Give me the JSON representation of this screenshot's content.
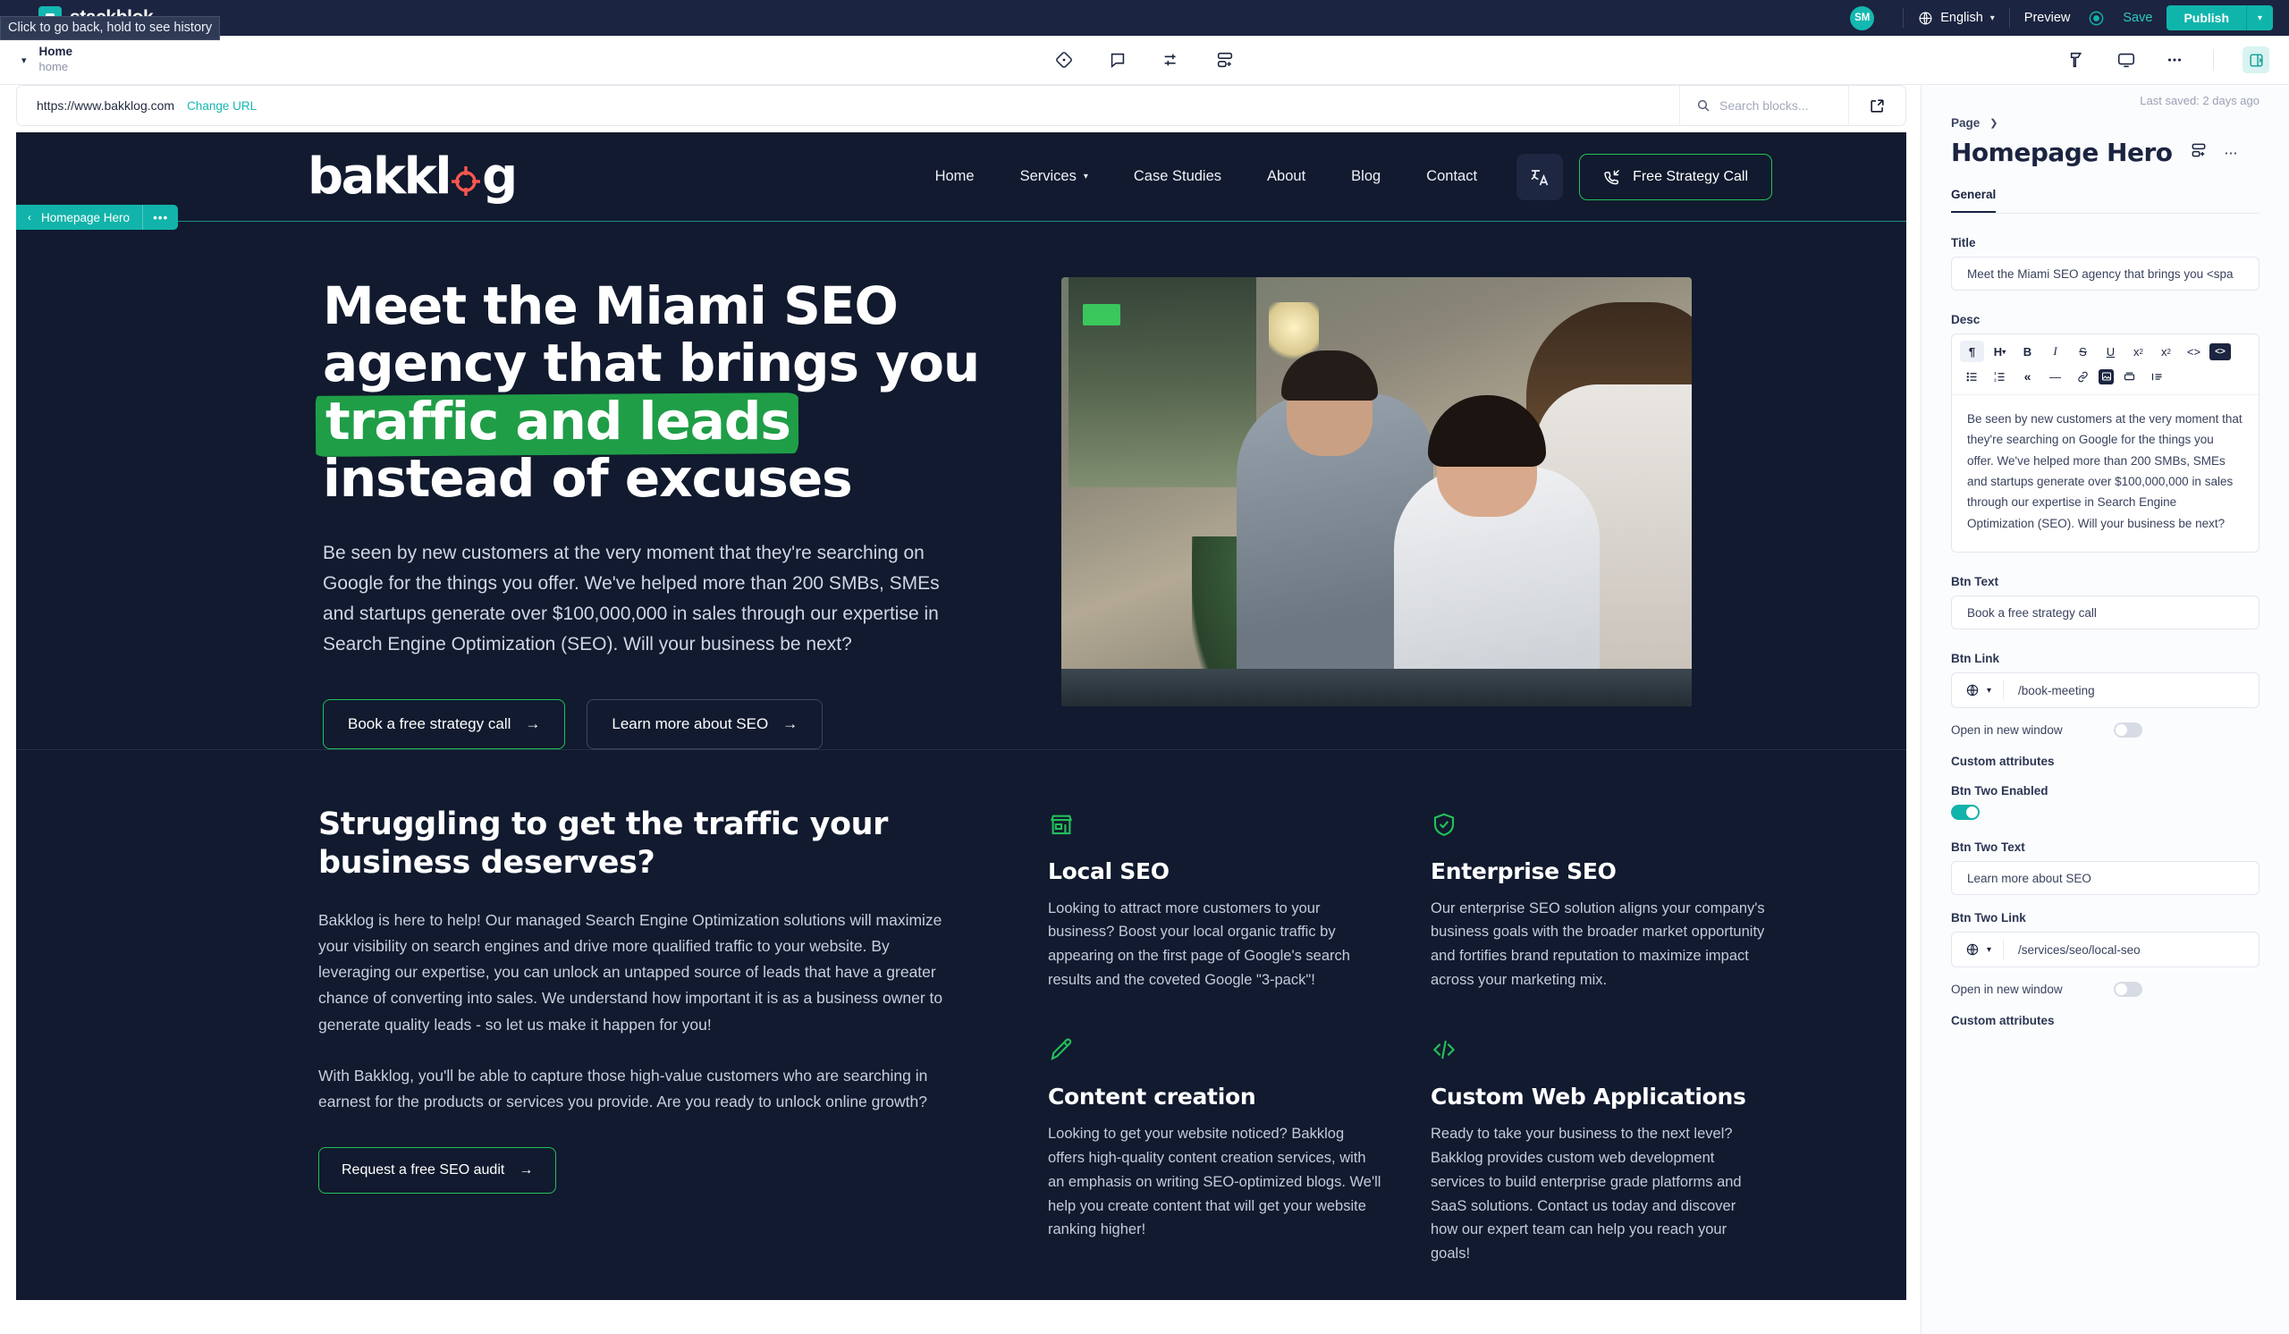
{
  "topbar": {
    "tooltip": "Click to go back, hold to see history",
    "brand": "stackblok",
    "avatar_initials": "SM",
    "language": "English",
    "preview_label": "Preview",
    "save_label": "Save",
    "publish_label": "Publish",
    "accent_teal": "#12b3aa",
    "bar_bg": "#1b2440"
  },
  "toolbar": {
    "page_name": "Home",
    "page_slug": "home",
    "icons": [
      "diamond-dot-icon",
      "comment-icon",
      "sliders-icon",
      "add-block-icon"
    ],
    "right_icons": [
      "tool-icon",
      "desktop-icon",
      "more-icon",
      "panel-toggle-icon"
    ]
  },
  "urlbar": {
    "url": "https://www.bakklog.com",
    "change_label": "Change URL",
    "search_placeholder": "Search blocks..."
  },
  "block_badge": {
    "label": "Homepage Hero",
    "dots": "•••"
  },
  "site": {
    "logo_text": "bakkl",
    "logo_text_tail": "g",
    "nav": [
      {
        "label": "Home",
        "has_caret": false
      },
      {
        "label": "Services",
        "has_caret": true
      },
      {
        "label": "Case Studies",
        "has_caret": false
      },
      {
        "label": "About",
        "has_caret": false
      },
      {
        "label": "Blog",
        "has_caret": false
      },
      {
        "label": "Contact",
        "has_caret": false
      }
    ],
    "nav_cta": "Free Strategy Call",
    "hero": {
      "h1_part1": "Meet the Miami SEO agency that brings you ",
      "h1_highlight": "traffic and leads",
      "h1_part2": " instead of excuses",
      "paragraph": "Be seen by new customers at the very moment that they're searching on Google for the things you offer. We've helped more than 200 SMBs, SMEs and startups generate over $100,000,000 in sales through our expertise in Search Engine Optimization (SEO). Will your business be next?",
      "btn_primary": "Book a free strategy call",
      "btn_secondary": "Learn more about SEO",
      "arrow": "→",
      "highlight_color": "#1f9e47"
    },
    "section2": {
      "heading": "Struggling to get the traffic your business deserves?",
      "paragraph1": "Bakklog is here to help! Our managed Search Engine Optimization solutions will maximize your visibility on search engines and drive more qualified traffic to your website. By leveraging our expertise, you can unlock an untapped source of leads that have a greater chance of converting into sales. We understand how important it is as a business owner to generate quality leads - so let us make it happen for you!",
      "paragraph2": "With Bakklog, you'll be able to capture those high-value customers who are searching in earnest for the products or services you provide. Are you ready to unlock online growth?",
      "button": "Request a free SEO audit",
      "cards": [
        {
          "icon": "storefront-icon",
          "title": "Local SEO",
          "text": "Looking to attract more customers to your business? Boost your local organic traffic by appearing on the first page of Google's search results and the coveted Google \"3-pack\"!"
        },
        {
          "icon": "shield-check-icon",
          "title": "Enterprise SEO",
          "text": "Our enterprise SEO solution aligns your company's business goals with the broader market opportunity and fortifies brand reputation to maximize impact across your marketing mix."
        },
        {
          "icon": "pencil-icon",
          "title": "Content creation",
          "text": "Looking to get your website noticed? Bakklog offers high-quality content creation services, with an emphasis on writing SEO-optimized blogs. We'll help you create content that will get your website ranking higher!"
        },
        {
          "icon": "code-icon",
          "title": "Custom Web Applications",
          "text": "Ready to take your business to the next level? Bakklog provides custom web development services to build enterprise grade platforms and SaaS solutions. Contact us today and discover how our expert team can help you reach your goals!"
        }
      ]
    }
  },
  "panel": {
    "last_saved": "Last saved: 2 days ago",
    "breadcrumb": "Page",
    "title": "Homepage Hero",
    "tab_general": "General",
    "fields": {
      "title_label": "Title",
      "title_value": "Meet the Miami SEO agency that brings you <spa",
      "desc_label": "Desc",
      "desc_value": "Be seen by new customers at the very moment that they're searching on Google for the things you offer. We've helped more than 200 SMBs, SMEs and startups generate over $100,000,000 in sales through our expertise in Search Engine Optimization (SEO). Will your business be next?",
      "btn_text_label": "Btn Text",
      "btn_text_value": "Book a free strategy call",
      "btn_link_label": "Btn Link",
      "btn_link_value": "/book-meeting",
      "open_new_window_label": "Open in new window",
      "custom_attributes_label": "Custom attributes",
      "btn_two_enabled_label": "Btn Two Enabled",
      "btn_two_text_label": "Btn Two Text",
      "btn_two_text_value": "Learn more about SEO",
      "btn_two_link_label": "Btn Two Link",
      "btn_two_link_value": "/services/seo/local-seo",
      "open_new_window_label2": "Open in new window",
      "custom_attributes_label2": "Custom attributes"
    },
    "rte_row1": [
      "pilcrow-icon",
      "heading-icon",
      "bold-icon",
      "italic-icon",
      "strikethrough-icon",
      "underline-icon",
      "superscript-icon",
      "subscript-icon",
      "code-icon",
      "code-block-icon"
    ],
    "rte_row2": [
      "bullet-list-icon",
      "numbered-list-icon",
      "blockquote-icon",
      "horizontal-rule-icon",
      "link-icon",
      "image-icon",
      "video-icon",
      "indent-icon"
    ]
  }
}
